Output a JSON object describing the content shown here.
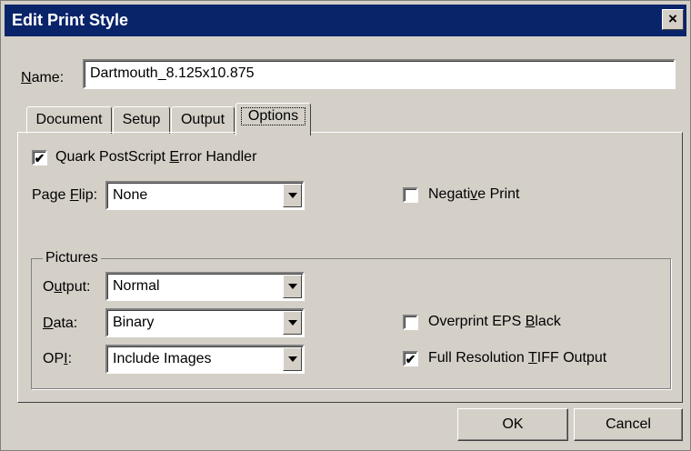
{
  "window": {
    "title": "Edit Print Style",
    "close_glyph": "×"
  },
  "name": {
    "label_key": "N",
    "label_rest": "ame:",
    "value": "Dartmouth_8.125x10.875"
  },
  "tabs": [
    {
      "label": "Document"
    },
    {
      "label": "Setup"
    },
    {
      "label": "Output"
    },
    {
      "label": "Options"
    }
  ],
  "options": {
    "error_handler": {
      "label_pre": "Quark PostScript ",
      "label_key": "E",
      "label_post": "rror Handler",
      "checked": true,
      "mark": "✔"
    },
    "page_flip": {
      "label_pre": "Page ",
      "label_key": "F",
      "label_post": "lip:",
      "value": "None"
    },
    "negative_print": {
      "label_pre": "Negati",
      "label_key": "v",
      "label_post": "e Print",
      "checked": false
    },
    "pictures": {
      "group_label": "Pictures",
      "output": {
        "label_pre": "O",
        "label_key": "u",
        "label_post": "tput:",
        "value": "Normal"
      },
      "data": {
        "label_pre": "",
        "label_key": "D",
        "label_post": "ata:",
        "value": "Binary"
      },
      "opi": {
        "label_pre": "OP",
        "label_key": "I",
        "label_post": ":",
        "value": "Include Images"
      },
      "overprint": {
        "label_pre": "Overprint EPS ",
        "label_key": "B",
        "label_post": "lack",
        "checked": false
      },
      "full_res": {
        "label_pre": "Full Resolution ",
        "label_key": "T",
        "label_post": "IFF Output",
        "checked": true,
        "mark": "✔"
      }
    }
  },
  "buttons": {
    "ok": "OK",
    "cancel": "Cancel"
  }
}
